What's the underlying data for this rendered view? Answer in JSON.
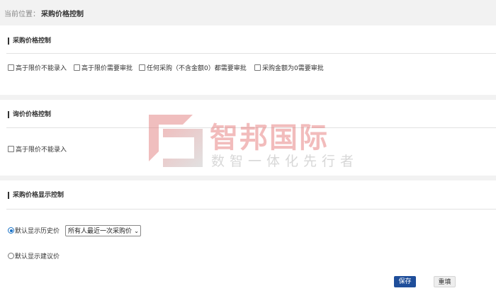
{
  "breadcrumb": {
    "label": "当前位置：",
    "current": "采购价格控制"
  },
  "sections": {
    "purchase": {
      "title": "采购价格控制",
      "options": [
        {
          "label": "高于限价不能录入",
          "checked": false
        },
        {
          "label": "高于限价需要审批",
          "checked": false
        },
        {
          "label": "任何采购（不含金额0）都需要审批",
          "checked": false
        },
        {
          "label": "采购金额为0需要审批",
          "checked": false
        }
      ]
    },
    "inquiry": {
      "title": "询价价格控制",
      "options": [
        {
          "label": "高于限价不能录入",
          "checked": false
        }
      ]
    },
    "display": {
      "title": "采购价格显示控制",
      "radio_history": {
        "label": "默认显示历史价",
        "selected": true
      },
      "history_select": {
        "value": "所有人最近一次采购价"
      },
      "radio_suggest": {
        "label": "默认显示建议价",
        "selected": false
      }
    }
  },
  "buttons": {
    "save": "保存",
    "reset": "重填"
  },
  "watermark": {
    "big": "智邦国际",
    "small": "数智一体化先行者"
  },
  "colors": {
    "primary_button": "#1f4e9a",
    "radio_accent": "#1a73c7",
    "watermark_red": "#dc5050"
  }
}
